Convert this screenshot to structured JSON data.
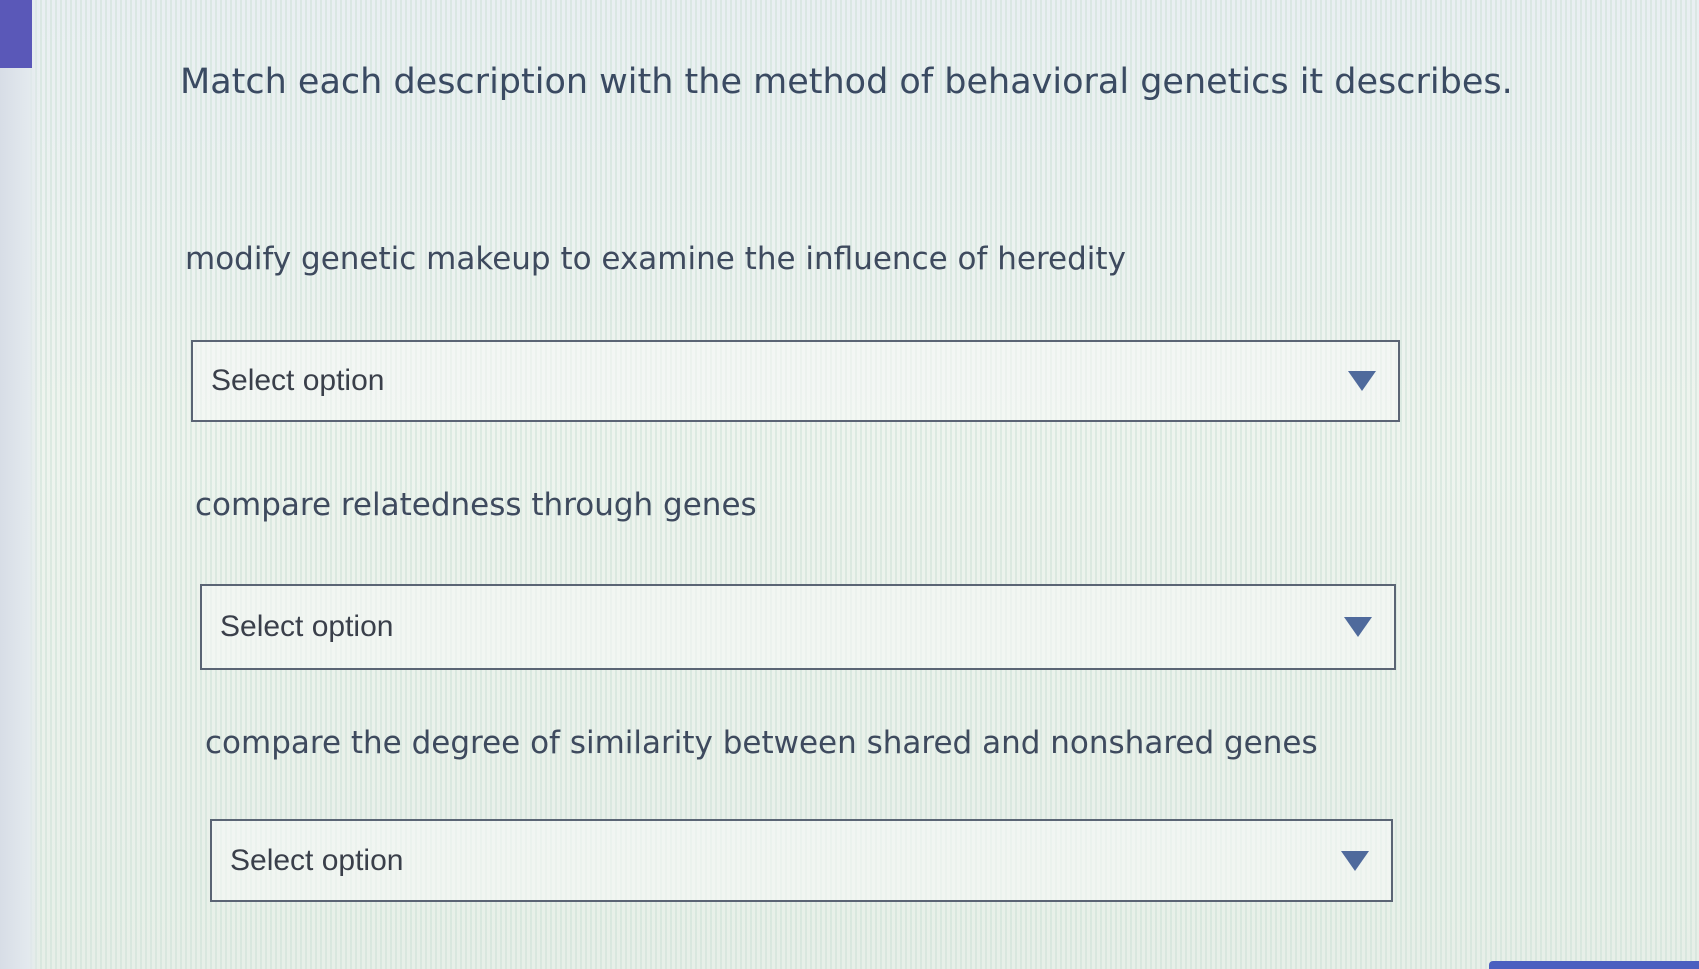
{
  "question": {
    "title": "Match each description with the method of behavioral genetics it describes."
  },
  "items": [
    {
      "description": "modify genetic makeup to examine the influence of heredity",
      "select_value": "Select option"
    },
    {
      "description": "compare relatedness through genes",
      "select_value": "Select option"
    },
    {
      "description": "compare the degree of similarity between shared and nonshared genes",
      "select_value": "Select option"
    }
  ],
  "icons": {
    "dropdown": "chevron-down-icon"
  },
  "colors": {
    "accent": "#5a58b8",
    "text": "#3a4a62",
    "dropdown_arrow": "#4f6a9c"
  }
}
